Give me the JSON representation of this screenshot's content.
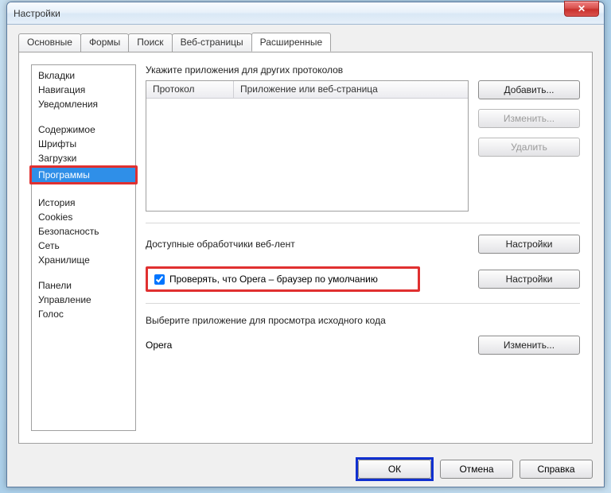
{
  "window": {
    "title": "Настройки"
  },
  "tabs": {
    "t0": "Основные",
    "t1": "Формы",
    "t2": "Поиск",
    "t3": "Веб-страницы",
    "t4": "Расширенные"
  },
  "sidebar": {
    "g0i0": "Вкладки",
    "g0i1": "Навигация",
    "g0i2": "Уведомления",
    "g1i0": "Содержимое",
    "g1i1": "Шрифты",
    "g1i2": "Загрузки",
    "g1i3": "Программы",
    "g2i0": "История",
    "g2i1": "Cookies",
    "g2i2": "Безопасность",
    "g2i3": "Сеть",
    "g2i4": "Хранилище",
    "g3i0": "Панели",
    "g3i1": "Управление",
    "g3i2": "Голос"
  },
  "main": {
    "protocols_label": "Укажите приложения для других протоколов",
    "col_protocol": "Протокол",
    "col_app": "Приложение или веб-страница",
    "btn_add": "Добавить...",
    "btn_edit": "Изменить...",
    "btn_delete": "Удалить",
    "feeds_label": "Доступные обработчики веб-лент",
    "btn_settings": "Настройки",
    "default_browser_check": "Проверять, что Opera – браузер по умолчанию",
    "source_viewer_label": "Выберите приложение для просмотра исходного кода",
    "source_viewer_value": "Opera",
    "btn_change": "Изменить..."
  },
  "footer": {
    "ok": "ОК",
    "cancel": "Отмена",
    "help": "Справка"
  }
}
